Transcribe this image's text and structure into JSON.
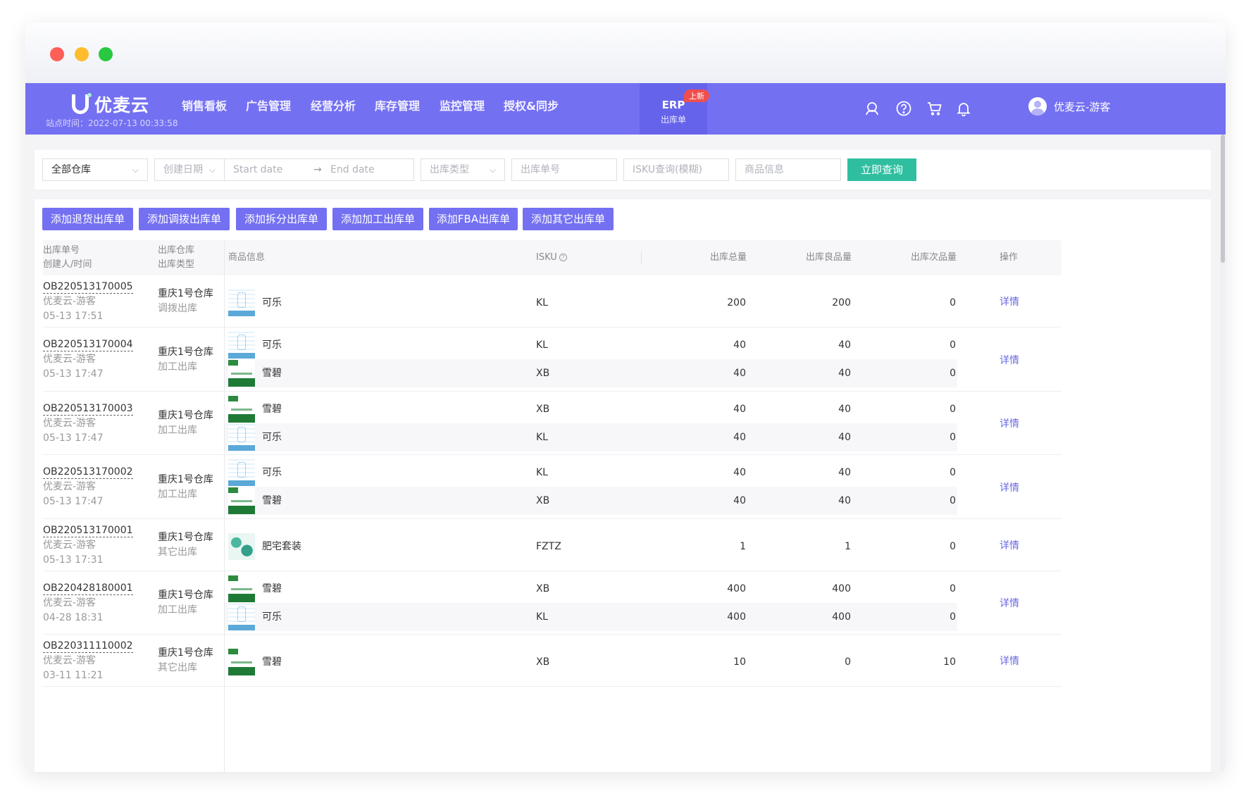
{
  "app": {
    "logo_text": "优麦云",
    "site_time": "站点时间：2022-07-13 00:33:58"
  },
  "nav": {
    "items": [
      "销售看板",
      "广告管理",
      "经营分析",
      "库存管理",
      "监控管理",
      "授权&同步"
    ],
    "active": {
      "title": "ERP",
      "subtitle": "出库单",
      "badge": "上新"
    },
    "user": "优麦云-游客"
  },
  "filters": {
    "warehouse": "全部仓库",
    "date_type": "创建日期",
    "start_date": "Start date",
    "arrow": "→",
    "end_date": "End date",
    "outbound_type": "出库类型",
    "order_no": "出库单号",
    "isku_query": "ISKU查询(模糊)",
    "product_info": "商品信息",
    "search_button": "立即查询"
  },
  "actions": [
    "添加退货出库单",
    "添加调拨出库单",
    "添加拆分出库单",
    "添加加工出库单",
    "添加FBA出库单",
    "添加其它出库单"
  ],
  "table": {
    "headers": {
      "order_no": "出库单号",
      "creator_time": "创建人/时间",
      "warehouse": "出库仓库",
      "type": "出库类型",
      "product": "商品信息",
      "isku": "ISKU",
      "total": "出库总量",
      "good": "出库良品量",
      "defective": "出库次品量",
      "operation": "操作"
    },
    "detail_label": "详情",
    "rows": [
      {
        "order_no": "OB220513170005",
        "creator": "优麦云-游客",
        "time": "05-13 17:51",
        "warehouse": "重庆1号仓库",
        "type": "调拨出库",
        "items": [
          {
            "thumb": "kl",
            "name": "可乐",
            "isku": "KL",
            "total": "200",
            "good": "200",
            "defective": "0"
          }
        ]
      },
      {
        "order_no": "OB220513170004",
        "creator": "优麦云-游客",
        "time": "05-13 17:47",
        "warehouse": "重庆1号仓库",
        "type": "加工出库",
        "items": [
          {
            "thumb": "kl",
            "name": "可乐",
            "isku": "KL",
            "total": "40",
            "good": "40",
            "defective": "0"
          },
          {
            "thumb": "xb",
            "name": "雪碧",
            "isku": "XB",
            "total": "40",
            "good": "40",
            "defective": "0"
          }
        ]
      },
      {
        "order_no": "OB220513170003",
        "creator": "优麦云-游客",
        "time": "05-13 17:47",
        "warehouse": "重庆1号仓库",
        "type": "加工出库",
        "items": [
          {
            "thumb": "xb",
            "name": "雪碧",
            "isku": "XB",
            "total": "40",
            "good": "40",
            "defective": "0"
          },
          {
            "thumb": "kl",
            "name": "可乐",
            "isku": "KL",
            "total": "40",
            "good": "40",
            "defective": "0"
          }
        ]
      },
      {
        "order_no": "OB220513170002",
        "creator": "优麦云-游客",
        "time": "05-13 17:47",
        "warehouse": "重庆1号仓库",
        "type": "加工出库",
        "items": [
          {
            "thumb": "kl",
            "name": "可乐",
            "isku": "KL",
            "total": "40",
            "good": "40",
            "defective": "0"
          },
          {
            "thumb": "xb",
            "name": "雪碧",
            "isku": "XB",
            "total": "40",
            "good": "40",
            "defective": "0"
          }
        ]
      },
      {
        "order_no": "OB220513170001",
        "creator": "优麦云-游客",
        "time": "05-13 17:31",
        "warehouse": "重庆1号仓库",
        "type": "其它出库",
        "items": [
          {
            "thumb": "fztz",
            "name": "肥宅套装",
            "isku": "FZTZ",
            "total": "1",
            "good": "1",
            "defective": "0"
          }
        ]
      },
      {
        "order_no": "OB220428180001",
        "creator": "优麦云-游客",
        "time": "04-28 18:31",
        "warehouse": "重庆1号仓库",
        "type": "加工出库",
        "items": [
          {
            "thumb": "xb",
            "name": "雪碧",
            "isku": "XB",
            "total": "400",
            "good": "400",
            "defective": "0"
          },
          {
            "thumb": "kl",
            "name": "可乐",
            "isku": "KL",
            "total": "400",
            "good": "400",
            "defective": "0"
          }
        ]
      },
      {
        "order_no": "OB220311110002",
        "creator": "优麦云-游客",
        "time": "03-11 11:21",
        "warehouse": "重庆1号仓库",
        "type": "其它出库",
        "items": [
          {
            "thumb": "xb",
            "name": "雪碧",
            "isku": "XB",
            "total": "10",
            "good": "0",
            "defective": "10"
          }
        ]
      }
    ]
  }
}
